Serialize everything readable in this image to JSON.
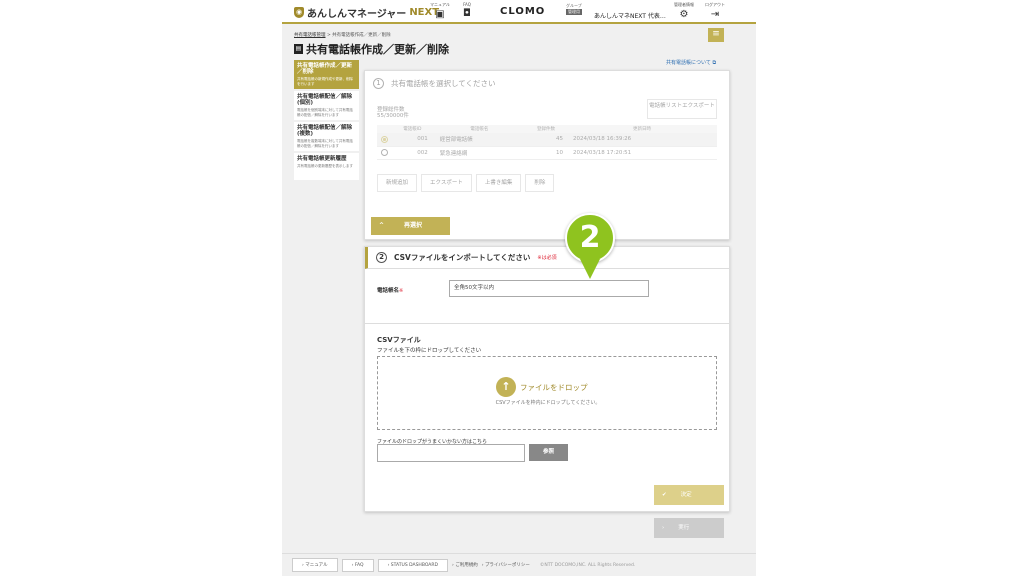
{
  "header": {
    "app_name": "あんしんマネージャー",
    "app_suffix": "NEXT",
    "manual_label": "マニュアル",
    "faq_label": "FAQ",
    "clomo_label": "CLOMO",
    "group_label": "グループ",
    "group_badge": "管理用",
    "group_name": "あんしんマネNEXT 代表…",
    "admin_label": "管理者情報",
    "logout_label": "ログアウト"
  },
  "breadcrumb": {
    "parent": "共有電話帳管理",
    "sep": ">",
    "current": "共有電話帳作成／更新／削除"
  },
  "page": {
    "title": "共有電話帳作成／更新／削除",
    "help_link": "共有電話帳について"
  },
  "sidebar": {
    "items": [
      {
        "title": "共有電話帳作成／更新／削除",
        "desc": "共有電話帳の新規作成や更新、削除を行います"
      },
      {
        "title": "共有電話帳配信／解除(個別)",
        "desc": "電話帳を個別端末に対して共有電話帳の配信／解除を行います"
      },
      {
        "title": "共有電話帳配信／解除(複数)",
        "desc": "電話帳を複数端末に対して共有電話帳の配信／解除を行います"
      },
      {
        "title": "共有電話帳更新履歴",
        "desc": "共有電話帳の更新履歴を表示します"
      }
    ]
  },
  "section1": {
    "num": "1",
    "title": "共有電話帳を選択してください",
    "count_label": "登録総件数",
    "count_value": "55/30000件",
    "export_label": "電話帳リストエクスポート",
    "columns": [
      "電話帳ID",
      "電話帳名",
      "登録件数",
      "更新日時"
    ],
    "rows": [
      {
        "id": "001",
        "name": "経営部電話帳",
        "count": "45",
        "updated": "2024/03/18 16:39:26"
      },
      {
        "id": "002",
        "name": "緊急連絡網",
        "count": "10",
        "updated": "2024/03/18 17:20:51"
      }
    ],
    "actions": [
      "新規追加",
      "エクスポート",
      "上書き編集",
      "削除"
    ],
    "reselect_label": "再選択"
  },
  "section2": {
    "num": "2",
    "title": "CSVファイルをインポートしてください",
    "required_note": "※は必須",
    "name_label": "電話帳名",
    "name_required": "※",
    "name_placeholder": "全角50文字以内",
    "csv_title": "CSVファイル",
    "csv_sub": "ファイルを下の枠にドロップしてください",
    "drop_label": "ファイルをドロップ",
    "drop_sub": "CSVファイルを枠内にドロップしてください。",
    "alt_label": "ファイルのドロップがうまくいかない方はこちら",
    "browse_label": "参照"
  },
  "buttons": {
    "confirm": "決定",
    "execute": "実行"
  },
  "callout": {
    "number": "2"
  },
  "footer": {
    "manual": "マニュアル",
    "faq": "FAQ",
    "status": "STATUS DASHBOARD",
    "terms": "ご利用規約",
    "privacy": "プライバシーポリシー",
    "copyright": "©NTT DOCOMO,INC. ALL Rights Reserved."
  },
  "colors": {
    "accent": "#b4a33f",
    "callout": "#8fc31f"
  }
}
